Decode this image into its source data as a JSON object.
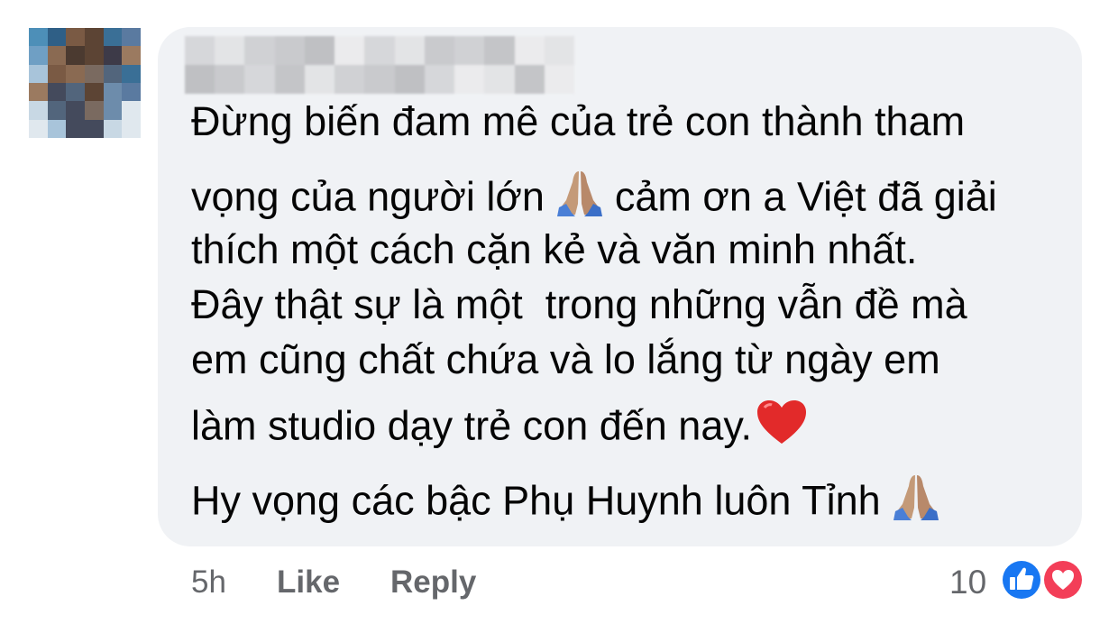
{
  "comment": {
    "author_name_blurred": true,
    "lines": [
      "Đừng biến đam mê của trẻ con thành tham",
      "vọng của người lớn",
      "cảm ơn a Việt đã giải",
      "thích một cách cặn kẻ và văn minh nhất.",
      "Đây thật sự là một  trong những vẫn đề mà",
      "em cũng chất chứa và lo lắng từ ngày em",
      "làm studio dạy trẻ con đến nay.",
      "Hy vọng các bậc Phụ Huynh luôn Tỉnh"
    ],
    "emojis": [
      "folded-hands-emoji",
      "red-heart-emoji",
      "folded-hands-emoji"
    ]
  },
  "actions": {
    "time": "5h",
    "like_label": "Like",
    "reply_label": "Reply"
  },
  "reactions": {
    "count": "10",
    "types": [
      "like-reaction-icon",
      "love-reaction-icon"
    ],
    "colors": {
      "like": "#1877f2",
      "love": "#f33e58"
    }
  }
}
